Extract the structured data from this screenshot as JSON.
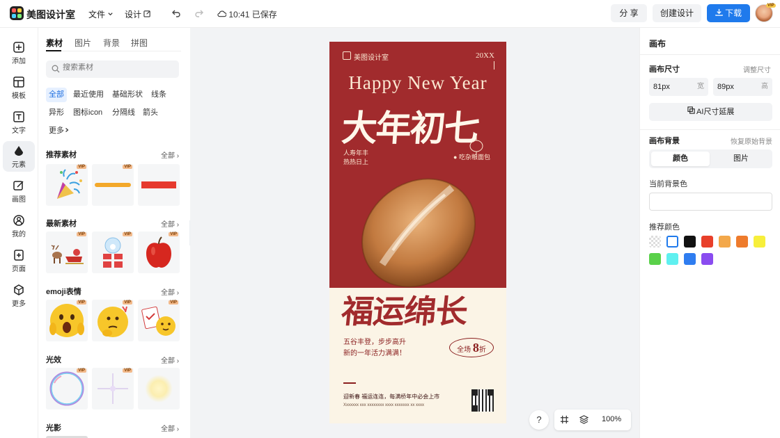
{
  "app": {
    "name": "美图设计室"
  },
  "topbar": {
    "file_menu": "文件",
    "design_menu": "设计",
    "save_status": "10:41 已保存",
    "share_label": "分 享",
    "create_label": "创建设计",
    "download_label": "下载",
    "avatar_badge": "VIP"
  },
  "leftnav": [
    {
      "label": "添加",
      "icon": "plus-square-icon"
    },
    {
      "label": "模板",
      "icon": "template-icon"
    },
    {
      "label": "文字",
      "icon": "text-icon"
    },
    {
      "label": "元素",
      "icon": "shapes-icon",
      "active": true
    },
    {
      "label": "画图",
      "icon": "edit-icon"
    },
    {
      "label": "我的",
      "icon": "user-icon"
    },
    {
      "label": "页面",
      "icon": "page-add-icon"
    },
    {
      "label": "更多",
      "icon": "cube-icon"
    }
  ],
  "panel": {
    "tabs": [
      "素材",
      "图片",
      "背景",
      "拼图"
    ],
    "search_placeholder": "搜索素材",
    "chips": [
      "全部",
      "最近使用",
      "基础形状",
      "线条",
      "异形",
      "图标icon",
      "分隔线",
      "箭头",
      "更多"
    ],
    "more_chip": "更多",
    "see_all": "全部",
    "vip": "VIP",
    "sections": [
      {
        "title": "推荐素材"
      },
      {
        "title": "最新素材"
      },
      {
        "title": "emoji表情"
      },
      {
        "title": "光效"
      },
      {
        "title": "光影"
      }
    ]
  },
  "poster": {
    "brand": "美图设计室",
    "year": "20XX",
    "english": "Happy New Year",
    "main": "大年初七",
    "left_small": [
      "人寿年丰",
      "热热日上"
    ],
    "right_small": "吃杂粮面包",
    "blessing": "福运绵长",
    "lines": [
      "五谷丰登，步步高升",
      "新的一年活力满满！"
    ],
    "sale_prefix": "全场",
    "sale_number": "8",
    "sale_suffix": "折",
    "bottom": [
      "迎新春 福运连连，每满桥年中必会上市",
      "Xxxxxxx xxx xxxxxxxx xxxx xxxxxxx xx xxxx"
    ]
  },
  "canvas_tools": {
    "help": "?",
    "zoom": "100%"
  },
  "rightpanel": {
    "title": "画布",
    "size_label": "画布尺寸",
    "adjust_size": "调整尺寸",
    "width_value": "81px",
    "width_unit": "宽",
    "height_value": "89px",
    "height_unit": "高",
    "ai_extend": "AI尺寸延展",
    "bg_label": "画布背景",
    "restore_bg": "恢复原始背景",
    "seg_color": "颜色",
    "seg_image": "图片",
    "current_bg": "当前背景色",
    "recommended": "推荐颜色",
    "swatches": [
      "transparent",
      "#ffffff",
      "#111111",
      "#e8402a",
      "#f3a84a",
      "#ee7b2c",
      "#f7ef3b",
      "#5ad14a",
      "#5ff0f0",
      "#2f7df0",
      "#8a4cf0"
    ]
  }
}
